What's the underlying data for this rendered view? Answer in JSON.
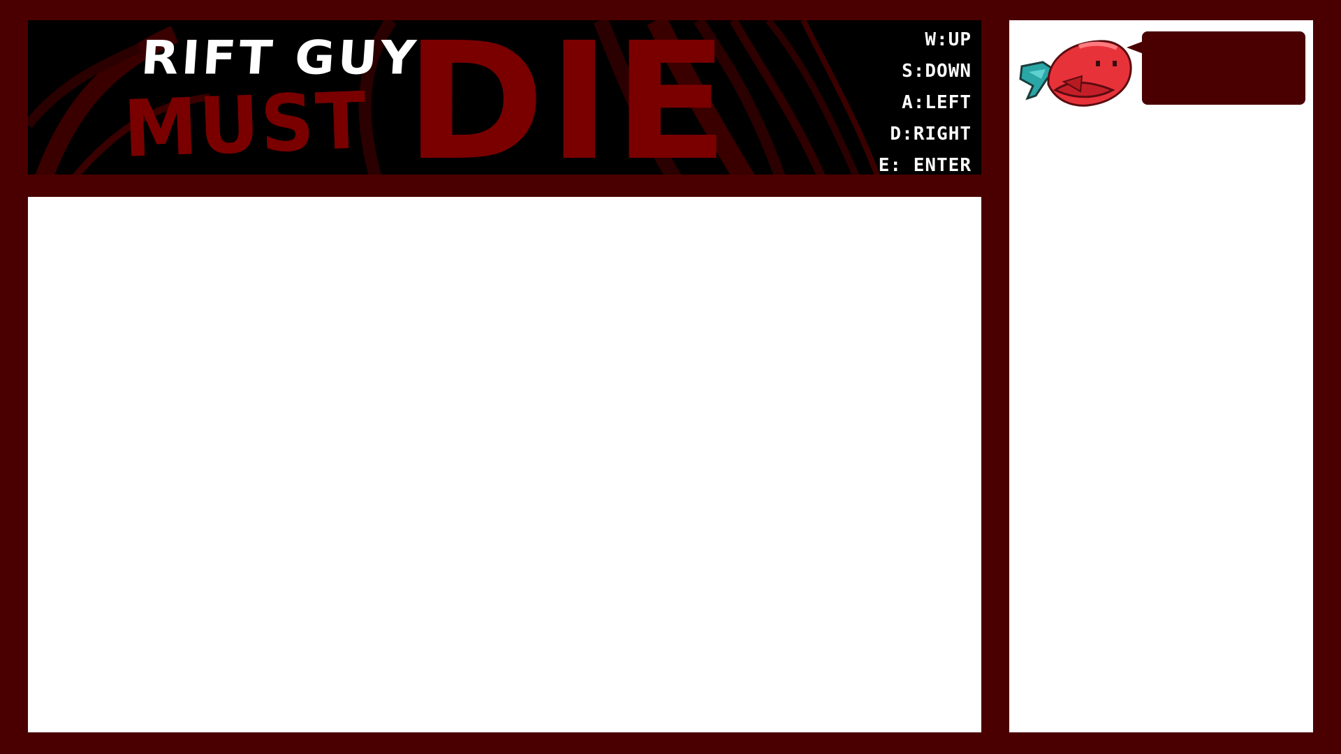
{
  "banner": {
    "title_line1": "Rift Guy",
    "title_must": "Must",
    "title_die": "Die"
  },
  "controls": [
    "W:UP",
    "S:DOWN",
    "A:LEFT",
    "D:RIGHT",
    "E: ENTER"
  ],
  "side_panel": {
    "mascot_icon": "red-fish-mascot-icon",
    "speech_text": ""
  },
  "colors": {
    "background": "#4a0000",
    "blood_red": "#7a0000",
    "panel": "#ffffff",
    "mascot_body": "#e8323a",
    "mascot_fin": "#2aa6a6"
  }
}
